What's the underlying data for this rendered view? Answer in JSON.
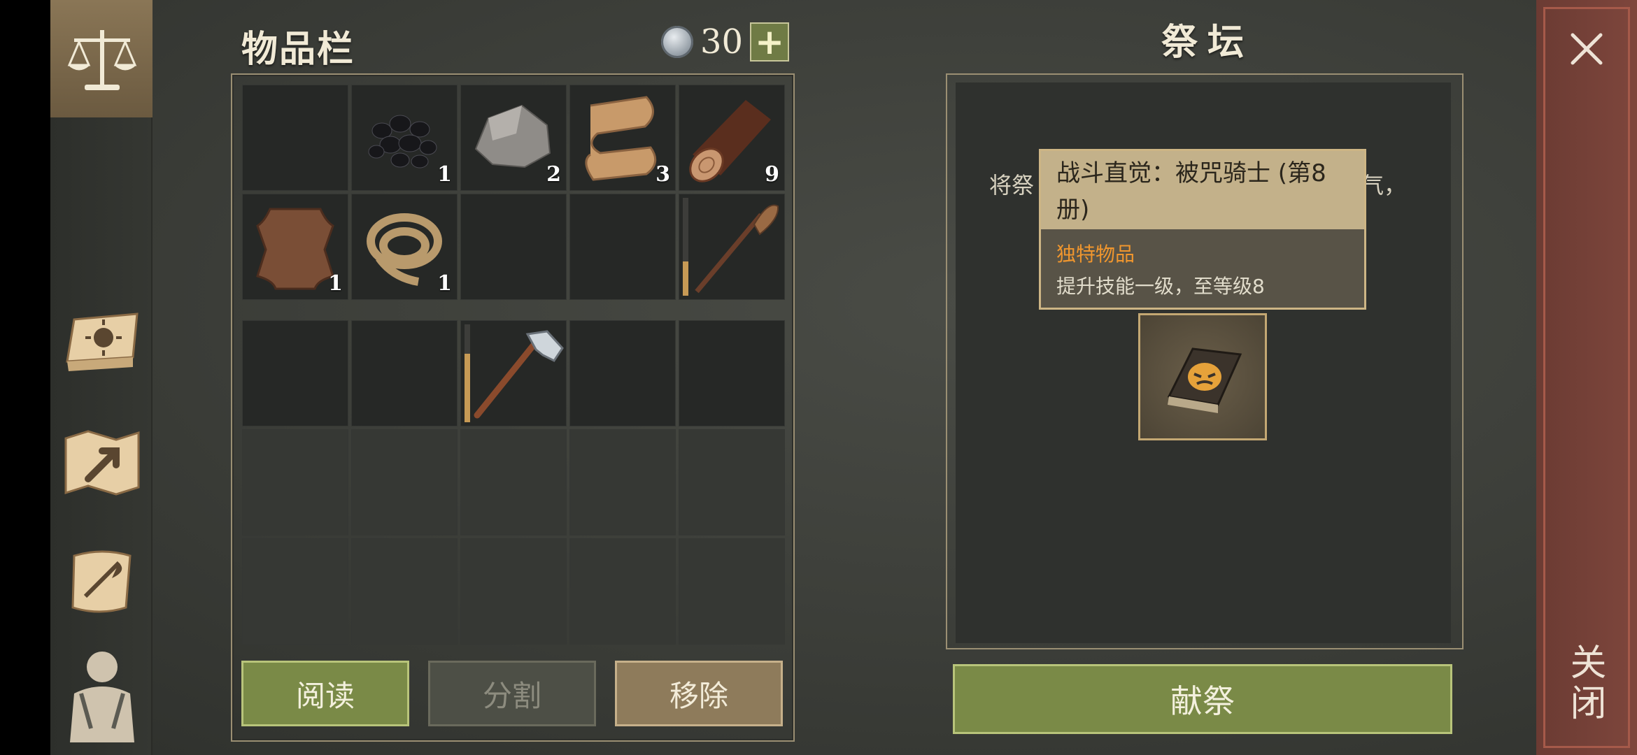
{
  "inventory": {
    "title": "物品栏",
    "currency_value": "30",
    "add_label": "+",
    "rows_top": [
      [
        {
          "icon": "empty",
          "count": ""
        },
        {
          "icon": "coal-icon",
          "count": "1"
        },
        {
          "icon": "stone-icon",
          "count": "2"
        },
        {
          "icon": "cloth-icon",
          "count": "3"
        },
        {
          "icon": "log-icon",
          "count": "9"
        }
      ],
      [
        {
          "icon": "leather-icon",
          "count": "1"
        },
        {
          "icon": "rope-icon",
          "count": "1"
        },
        {
          "icon": "empty",
          "count": ""
        },
        {
          "icon": "empty",
          "count": ""
        },
        {
          "icon": "oar-icon",
          "count": "",
          "durability": 0.35
        }
      ]
    ],
    "rows_bottom_axe_durability": 0.7,
    "buttons": {
      "read": "阅读",
      "split": "分割",
      "remove": "移除"
    }
  },
  "altar": {
    "title": "祭坛",
    "desc_line1_left": "将祭",
    "desc_line1_right": "气，",
    "tooltip": {
      "title": "战斗直觉：被咒骑士 (第8册)",
      "tag": "独特物品",
      "desc": "提升技能一级，至等级8"
    },
    "offer_label": "献祭"
  },
  "close": {
    "label": "关闭"
  },
  "colors": {
    "accent_green": "#7a8a47",
    "accent_orange": "#f0962e",
    "frame": "#9b8f73"
  }
}
